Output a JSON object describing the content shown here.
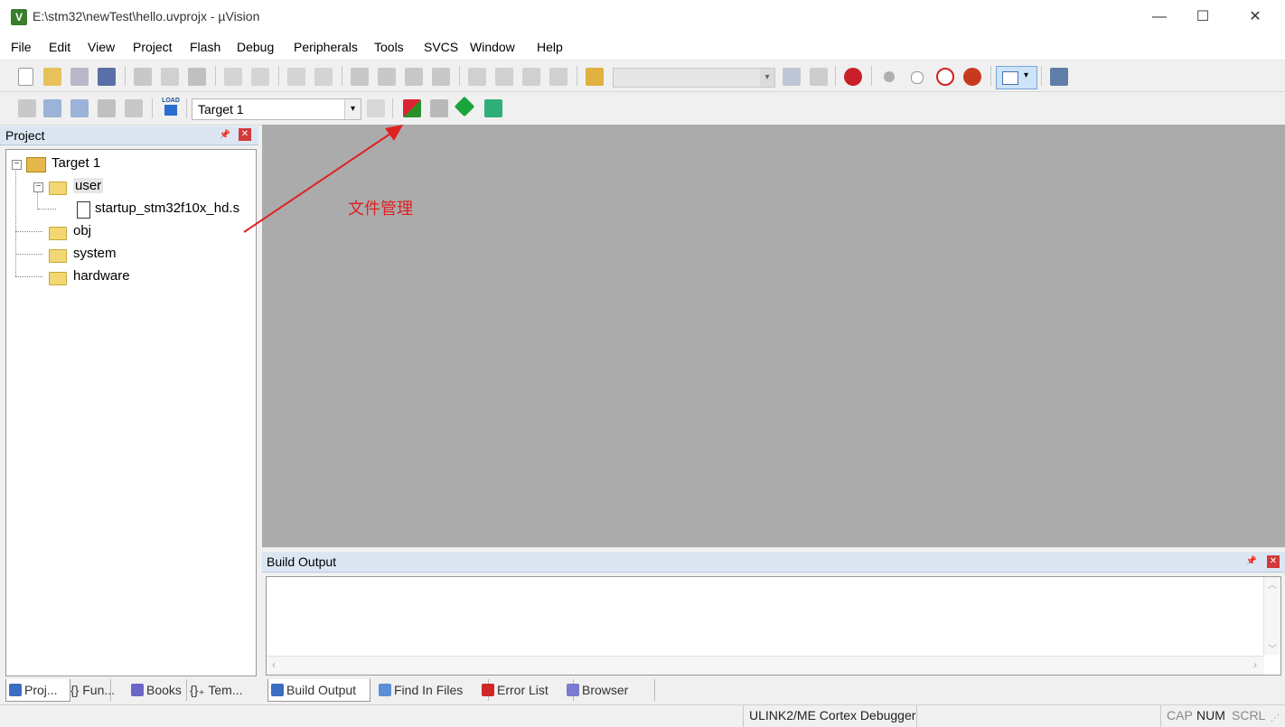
{
  "window": {
    "title": "E:\\stm32\\newTest\\hello.uvprojx - µVision",
    "app_icon_letter": "V",
    "minimize": "—",
    "maximize": "☐",
    "close": "✕"
  },
  "menu": [
    "File",
    "Edit",
    "View",
    "Project",
    "Flash",
    "Debug",
    "Peripherals",
    "Tools",
    "SVCS",
    "Window",
    "Help"
  ],
  "toolbar2": {
    "target_select": "Target 1",
    "load_label": "LOAD"
  },
  "project_panel": {
    "title": "Project",
    "tree": {
      "root": "Target 1",
      "groups": [
        {
          "name": "user",
          "files": [
            "startup_stm32f10x_hd.s"
          ]
        },
        {
          "name": "obj"
        },
        {
          "name": "system"
        },
        {
          "name": "hardware"
        }
      ]
    }
  },
  "annotation": "文件管理",
  "build_output": {
    "title": "Build Output"
  },
  "left_tabs": [
    "Proj...",
    "{} Fun...",
    "Books",
    "{}₊ Tem..."
  ],
  "bottom_tabs": [
    "Build Output",
    "Find In Files",
    "Error List",
    "Browser"
  ],
  "status": {
    "debugger": "ULINK2/ME Cortex Debugger",
    "cap": "CAP",
    "num": "NUM",
    "scrl": "SCRL"
  },
  "colors": {
    "annotation": "#e02020",
    "editor_bg": "#ababab",
    "panel_header": "#dce6f3"
  }
}
